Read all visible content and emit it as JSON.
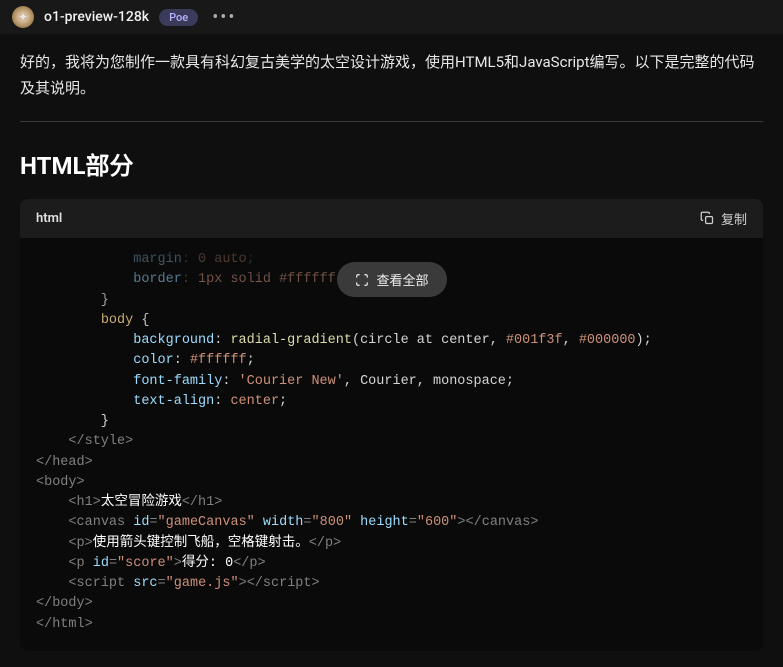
{
  "header": {
    "bot_name": "o1-preview-128k",
    "poe_label": "Poe",
    "more_label": "•••"
  },
  "message": {
    "intro": "好的，我将为您制作一款具有科幻复古美学的太空设计游戏，使用HTML5和JavaScript编写。以下是完整的代码及其说明。",
    "section_title": "HTML部分"
  },
  "code": {
    "lang_label": "html",
    "copy_label": "复制",
    "expand_label": "查看全部",
    "lines": {
      "l1_prop": "margin",
      "l1_val": "0 auto",
      "l2_prop": "border",
      "l2_val1": "1px",
      "l2_val2": "solid",
      "l2_val3": "#ffffff",
      "l4_sel": "body",
      "l5_prop": "background",
      "l5_fn": "radial-gradient",
      "l5_arg1": "circle at center",
      "l5_arg2": "#001f3f",
      "l5_arg3": "#000000",
      "l6_prop": "color",
      "l6_val": "#ffffff",
      "l7_prop": "font-family",
      "l7_val1": "'Courier New'",
      "l7_val2": "Courier",
      "l7_val3": "monospace",
      "l8_prop": "text-align",
      "l8_val": "center",
      "l10_tag": "style",
      "l11_tag": "head",
      "l12_tag": "body",
      "l13_tag": "h1",
      "l13_text": "太空冒险游戏",
      "l14_tag": "canvas",
      "l14_a1": "id",
      "l14_v1": "gameCanvas",
      "l14_a2": "width",
      "l14_v2": "800",
      "l14_a3": "height",
      "l14_v3": "600",
      "l15_tag": "p",
      "l15_text": "使用箭头键控制飞船，空格键射击。",
      "l16_tag": "p",
      "l16_a1": "id",
      "l16_v1": "score",
      "l16_text": "得分: 0",
      "l17_tag": "script",
      "l17_a1": "src",
      "l17_v1": "game.js",
      "l18_tag": "body",
      "l19_tag": "html"
    }
  }
}
